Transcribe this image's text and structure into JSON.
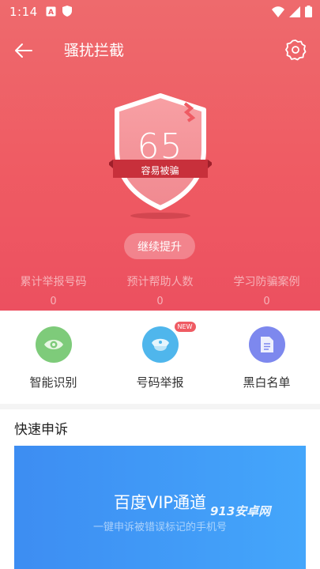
{
  "status_bar": {
    "time": "1:14",
    "icons_left": [
      "a-notification-icon",
      "shield-notification-icon"
    ],
    "icons_right": [
      "wifi-icon",
      "signal-icon",
      "battery-icon"
    ]
  },
  "header": {
    "title": "骚扰拦截"
  },
  "protection": {
    "score": "65",
    "status": "容易被骗",
    "button_label": "继续提升"
  },
  "stats": [
    {
      "label": "累计举报号码",
      "value": "0"
    },
    {
      "label": "预计帮助人数",
      "value": "0"
    },
    {
      "label": "学习防骗案例",
      "value": "0"
    }
  ],
  "shortcuts": [
    {
      "label": "智能识别",
      "icon": "eye-icon",
      "color": "#7ecb7a"
    },
    {
      "label": "号码举报",
      "icon": "police-cap-icon",
      "color": "#4fb6ec",
      "badge": "NEW"
    },
    {
      "label": "黑白名单",
      "icon": "document-icon",
      "color": "#7d88ee"
    }
  ],
  "quick_appeal": {
    "title": "快速申诉",
    "card_title": "百度VIP通道",
    "card_subtitle": "一键申诉被错误标记的手机号",
    "watermark": "913安卓网"
  },
  "colors": {
    "hero": "#ef5b63",
    "card": "#3d8df2"
  }
}
